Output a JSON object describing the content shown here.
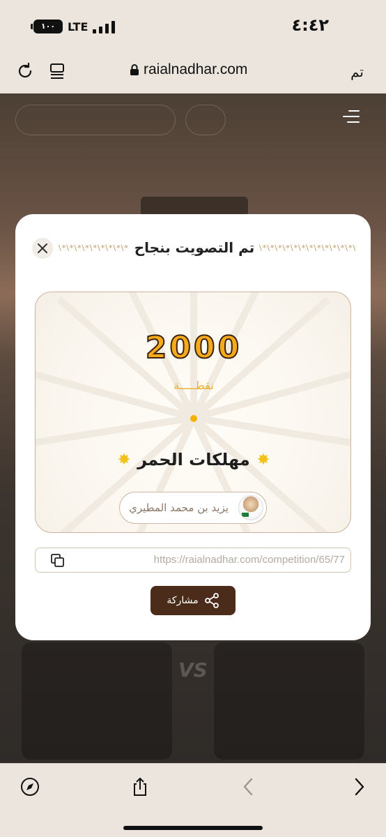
{
  "status_bar": {
    "battery": "١٠٠",
    "network": "LTE",
    "time": "٤:٤٢"
  },
  "browser": {
    "url": "raialnadhar.com",
    "done_label": "تم"
  },
  "modal": {
    "title": "تم التصويت بنجاح",
    "decoration": "\\*\\*\\*\\*\\*\\*\\*\\*\\*\\*\\*\\*\\*\\*\\*",
    "points": "2000",
    "points_label": "نقطـــــة",
    "team_name": "مهلكات الحمر",
    "voter_name": "يزيد بن محمد المطيري",
    "share_link": "https://raialnadhar.com/competition/65/77",
    "share_button": "مشاركة"
  },
  "colors": {
    "accent": "#f6a91b",
    "button_bg": "#4b2c1a",
    "border": "#c9b49d"
  },
  "icons": [
    "reload-icon",
    "reader-icon",
    "lock-icon",
    "close-icon",
    "copy-icon",
    "share-icon",
    "compass-icon",
    "share-sheet-icon",
    "back-icon",
    "forward-icon",
    "menu-icon"
  ]
}
